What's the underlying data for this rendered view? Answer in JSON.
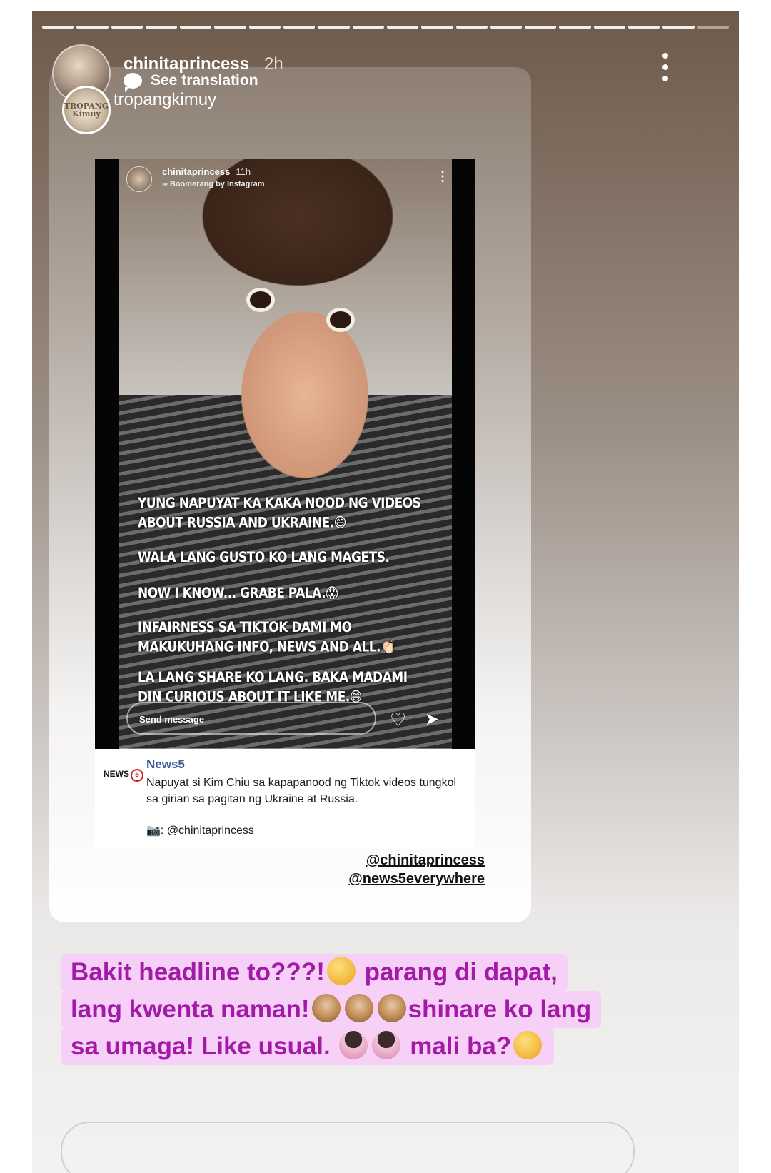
{
  "story": {
    "progress_segments": 20,
    "progress_seen": 19,
    "username": "chinitaprincess",
    "time": "2h",
    "translate_label": "See translation",
    "reposted_from": "tropangkimuy",
    "avatar_badge": "TROPANG Kimuy"
  },
  "inner_story": {
    "username": "chinitaprincess",
    "time": "11h",
    "subtitle": "∞ Boomerang by Instagram",
    "more": "⋮",
    "captions": [
      "YUNG NAPUYAT KA KAKA NOOD NG VIDEOS ABOUT RUSSIA AND UKRAINE.😄",
      "WALA LANG GUSTO KO LANG MAGETS.",
      "NOW I KNOW... GRABE PALA.😱",
      "INFAIRNESS SA TIKTOK DAMI MO MAKUKUHANG INFO, NEWS AND ALL.👏🏻",
      "LA LANG SHARE KO LANG. BAKA MADAMI DIN CURIOUS ABOUT IT LIKE ME.😄"
    ],
    "send_placeholder": "Send message",
    "heart": "♡",
    "send": "➤"
  },
  "news": {
    "logo": "NEWS",
    "logo_number": "5",
    "name": "News5",
    "text": "Napuyat si Kim Chiu sa kapapanood ng Tiktok videos tungkol sa girian sa pagitan ng Ukraine at Russia.",
    "credit": "📷: @chinitaprincess"
  },
  "mentions": [
    "@chinitaprincess",
    "@news5everywhere"
  ],
  "bottom_text": {
    "line1a": "Bakit headline to???!",
    "line1b": " parang di dapat,",
    "line2a": "lang kwenta naman!",
    "line2b": "shinare ko lang",
    "line3a": "sa umaga! Like usual. ",
    "line3b": " mali ba?"
  },
  "colors": {
    "highlight": "#f6d0f6",
    "text_purple": "#a31aa8",
    "news_blue": "#3e5c96",
    "news_red": "#d21e1e"
  }
}
